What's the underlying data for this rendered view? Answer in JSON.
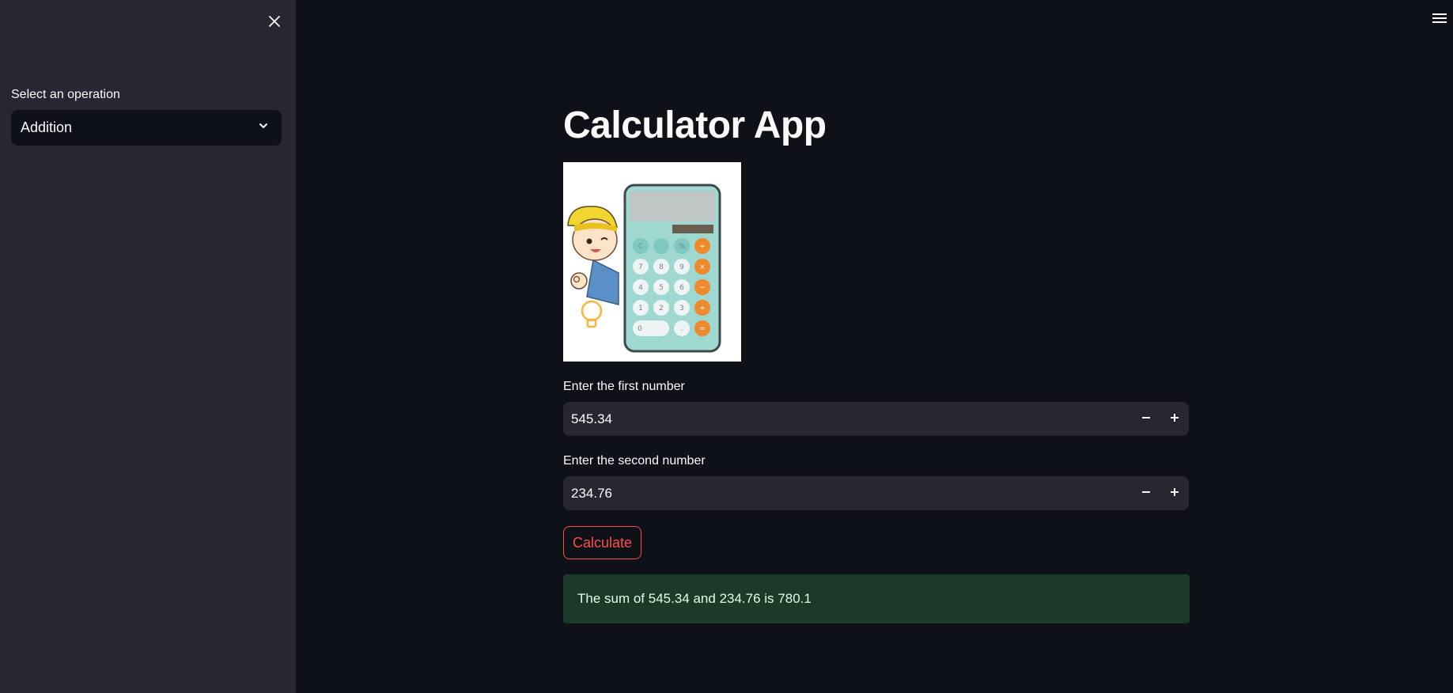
{
  "sidebar": {
    "close_icon": "close-icon",
    "operation_label": "Select an operation",
    "operation_selected": "Addition",
    "dropdown_icon": "chevron-down-icon"
  },
  "header": {
    "menu_icon": "hamburger-menu-icon"
  },
  "main": {
    "title": "Calculator App",
    "image": "calculator-worker-illustration",
    "first_number_label": "Enter the first number",
    "first_number_value": "545.34",
    "second_number_label": "Enter the second number",
    "second_number_value": "234.76",
    "calculate_label": "Calculate",
    "result_text": "The sum of 545.34 and 234.76 is 780.1"
  },
  "colors": {
    "background": "#0e1117",
    "sidebar": "#262730",
    "accent": "#ff4b4b",
    "success_bg": "#1b3a2a",
    "success_text": "#dffde9"
  }
}
